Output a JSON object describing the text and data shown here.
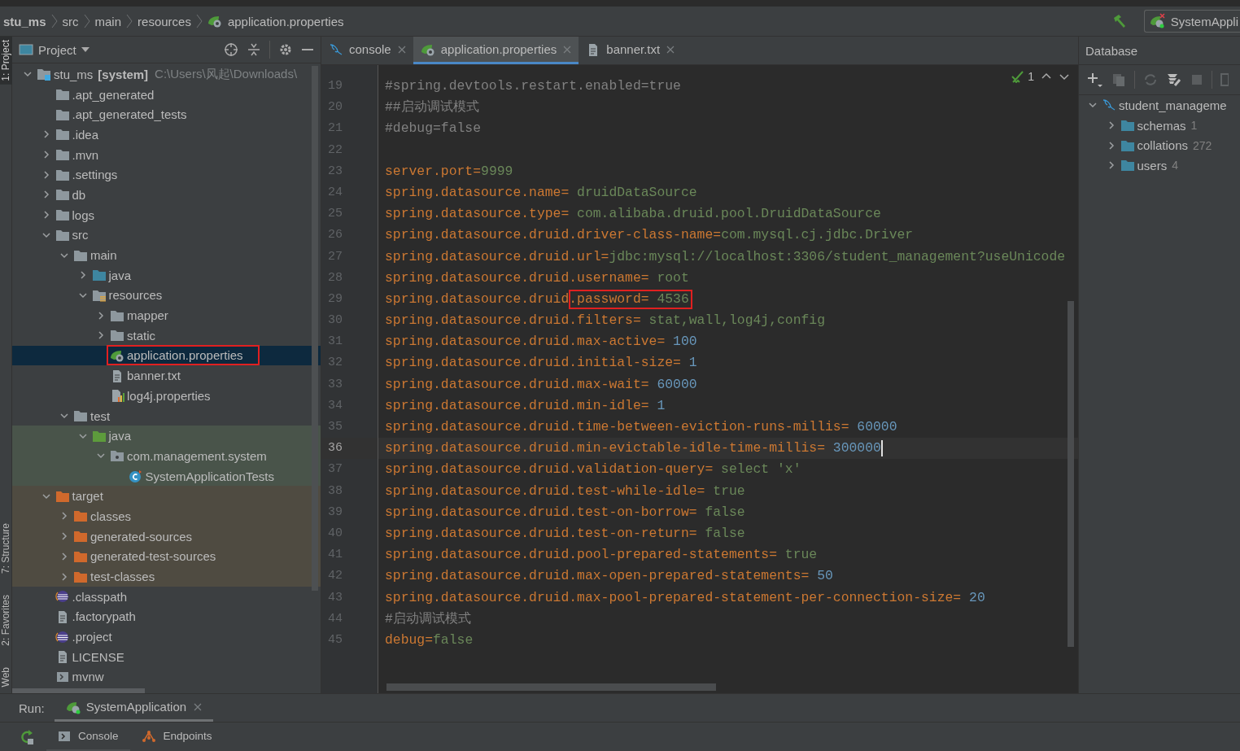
{
  "breadcrumbs": [
    {
      "label": "stu_ms",
      "bold": true
    },
    {
      "label": "src",
      "bold": false
    },
    {
      "label": "main",
      "bold": false
    },
    {
      "label": "resources",
      "bold": false
    },
    {
      "label": "application.properties",
      "bold": false,
      "kind": "spring"
    }
  ],
  "run_config": {
    "label": "SystemAppli"
  },
  "tool_strip": [
    {
      "label": "1: Project",
      "selected": true
    },
    {
      "label": "7: Structure",
      "selected": false
    },
    {
      "label": "2: Favorites",
      "selected": false
    },
    {
      "label": "Web",
      "selected": false
    }
  ],
  "project": {
    "title": "Project",
    "tree": [
      {
        "label": "stu_ms",
        "module": "[system]",
        "path": "C:\\Users\\风起\\Downloads\\",
        "kind": "module",
        "expanded": true,
        "selected": false,
        "children": [
          {
            "label": ".apt_generated",
            "kind": "folder",
            "selected": false
          },
          {
            "label": ".apt_generated_tests",
            "kind": "folder",
            "selected": false
          },
          {
            "label": ".idea",
            "kind": "folder",
            "expanded": false,
            "selected": false
          },
          {
            "label": ".mvn",
            "kind": "folder",
            "expanded": false,
            "selected": false
          },
          {
            "label": ".settings",
            "kind": "folder",
            "expanded": false,
            "selected": false
          },
          {
            "label": "db",
            "kind": "folder",
            "expanded": false,
            "selected": false
          },
          {
            "label": "logs",
            "kind": "folder",
            "expanded": false,
            "selected": false
          },
          {
            "label": "src",
            "kind": "folder",
            "expanded": true,
            "selected": false,
            "children": [
              {
                "label": "main",
                "kind": "folder",
                "expanded": true,
                "selected": false,
                "children": [
                  {
                    "label": "java",
                    "kind": "source",
                    "expanded": false,
                    "selected": false
                  },
                  {
                    "label": "resources",
                    "kind": "resources",
                    "expanded": true,
                    "selected": false,
                    "children": [
                      {
                        "label": "mapper",
                        "kind": "folder",
                        "expanded": false,
                        "selected": false
                      },
                      {
                        "label": "static",
                        "kind": "folder",
                        "expanded": false,
                        "selected": false
                      },
                      {
                        "label": "application.properties",
                        "kind": "spring",
                        "selected": true,
                        "boxed": true
                      },
                      {
                        "label": "banner.txt",
                        "kind": "text",
                        "selected": false
                      },
                      {
                        "label": "log4j.properties",
                        "kind": "log4j",
                        "selected": false
                      }
                    ]
                  }
                ]
              },
              {
                "label": "test",
                "kind": "folder",
                "expanded": true,
                "selected": false,
                "children": [
                  {
                    "label": "java",
                    "kind": "test",
                    "expanded": true,
                    "selected": false,
                    "children": [
                      {
                        "label": "com.management.system",
                        "kind": "package",
                        "expanded": true,
                        "selected": false,
                        "children": [
                          {
                            "label": "SystemApplicationTests",
                            "kind": "class",
                            "selected": false
                          }
                        ]
                      }
                    ]
                  }
                ]
              }
            ]
          },
          {
            "label": "target",
            "kind": "excluded",
            "expanded": true,
            "selected": false,
            "children": [
              {
                "label": "classes",
                "kind": "excluded",
                "expanded": false,
                "selected": false
              },
              {
                "label": "generated-sources",
                "kind": "excluded",
                "expanded": false,
                "selected": false
              },
              {
                "label": "generated-test-sources",
                "kind": "excluded",
                "expanded": false,
                "selected": false
              },
              {
                "label": "test-classes",
                "kind": "excluded",
                "expanded": false,
                "selected": false
              }
            ]
          },
          {
            "label": ".classpath",
            "kind": "eclipse",
            "selected": false
          },
          {
            "label": ".factorypath",
            "kind": "file",
            "selected": false
          },
          {
            "label": ".project",
            "kind": "eclipse",
            "selected": false
          },
          {
            "label": "LICENSE",
            "kind": "file",
            "selected": false
          },
          {
            "label": "mvnw",
            "kind": "script",
            "selected": false
          }
        ]
      }
    ]
  },
  "editor": {
    "tabs": [
      {
        "label": "console",
        "kind": "mysql",
        "selected": false
      },
      {
        "label": "application.properties",
        "kind": "spring",
        "selected": true
      },
      {
        "label": "banner.txt",
        "kind": "text",
        "selected": false
      }
    ],
    "inspection_count": "1",
    "lines": [
      {
        "number": "19",
        "current": false,
        "segments": [
          {
            "kind": "comment",
            "text": "#spring.devtools.restart.enabled=true"
          }
        ]
      },
      {
        "number": "20",
        "current": false,
        "segments": [
          {
            "kind": "comment",
            "text": "##启动调试模式"
          }
        ]
      },
      {
        "number": "21",
        "current": false,
        "segments": [
          {
            "kind": "comment",
            "text": "#debug=false"
          }
        ]
      },
      {
        "number": "22",
        "current": false
      },
      {
        "number": "23",
        "current": false,
        "segments": [
          {
            "kind": "key",
            "text": "server.port="
          },
          {
            "kind": "value",
            "text": "9999"
          }
        ]
      },
      {
        "number": "24",
        "current": false,
        "segments": [
          {
            "kind": "key",
            "text": "spring.datasource.name="
          },
          {
            "kind": "value",
            "text": " druidDataSource"
          }
        ]
      },
      {
        "number": "25",
        "current": false,
        "segments": [
          {
            "kind": "key",
            "text": "spring.datasource.type="
          },
          {
            "kind": "value",
            "text": " com.alibaba.druid.pool.DruidDataSource"
          }
        ]
      },
      {
        "number": "26",
        "current": false,
        "segments": [
          {
            "kind": "key",
            "text": "spring.datasource.druid.driver-class-name="
          },
          {
            "kind": "value",
            "text": "com.mysql.cj.jdbc.Driver"
          }
        ]
      },
      {
        "number": "27",
        "current": false,
        "segments": [
          {
            "kind": "key",
            "text": "spring.datasource.druid.url="
          },
          {
            "kind": "value",
            "text": "jdbc:mysql://localhost:3306/student_management?useUnicode"
          }
        ]
      },
      {
        "number": "28",
        "current": false,
        "segments": [
          {
            "kind": "key",
            "text": "spring.datasource.druid.username="
          },
          {
            "kind": "value",
            "text": " root"
          }
        ]
      },
      {
        "number": "29",
        "current": false,
        "segments": [
          {
            "kind": "key",
            "text": "spring.datasource.druid"
          },
          {
            "kind": "key",
            "text": ".password=",
            "boxed": true
          },
          {
            "kind": "value",
            "text": " 4536",
            "boxed": true
          }
        ]
      },
      {
        "number": "30",
        "current": false,
        "segments": [
          {
            "kind": "key",
            "text": "spring.datasource.druid.filters="
          },
          {
            "kind": "value",
            "text": " stat,wall,log4j,config"
          }
        ]
      },
      {
        "number": "31",
        "current": false,
        "segments": [
          {
            "kind": "key",
            "text": "spring.datasource.druid.max-active="
          },
          {
            "kind": "number",
            "text": " 100"
          }
        ]
      },
      {
        "number": "32",
        "current": false,
        "segments": [
          {
            "kind": "key",
            "text": "spring.datasource.druid.initial-size="
          },
          {
            "kind": "number",
            "text": " 1"
          }
        ]
      },
      {
        "number": "33",
        "current": false,
        "segments": [
          {
            "kind": "key",
            "text": "spring.datasource.druid.max-wait="
          },
          {
            "kind": "number",
            "text": " 60000"
          }
        ]
      },
      {
        "number": "34",
        "current": false,
        "segments": [
          {
            "kind": "key",
            "text": "spring.datasource.druid.min-idle="
          },
          {
            "kind": "number",
            "text": " 1"
          }
        ]
      },
      {
        "number": "35",
        "current": false,
        "segments": [
          {
            "kind": "key",
            "text": "spring.datasource.druid.time-between-eviction-runs-millis="
          },
          {
            "kind": "number",
            "text": " 60000"
          }
        ]
      },
      {
        "number": "36",
        "current": true,
        "segments": [
          {
            "kind": "key",
            "text": "spring.datasource.druid.min-evictable-idle-time-millis="
          },
          {
            "kind": "number",
            "text": " 300000"
          }
        ]
      },
      {
        "number": "37",
        "current": false,
        "segments": [
          {
            "kind": "key",
            "text": "spring.datasource.druid.validation-query="
          },
          {
            "kind": "value",
            "text": " select 'x'"
          }
        ]
      },
      {
        "number": "38",
        "current": false,
        "segments": [
          {
            "kind": "key",
            "text": "spring.datasource.druid.test-while-idle="
          },
          {
            "kind": "value",
            "text": " true"
          }
        ]
      },
      {
        "number": "39",
        "current": false,
        "segments": [
          {
            "kind": "key",
            "text": "spring.datasource.druid.test-on-borrow="
          },
          {
            "kind": "value",
            "text": " false"
          }
        ]
      },
      {
        "number": "40",
        "current": false,
        "segments": [
          {
            "kind": "key",
            "text": "spring.datasource.druid.test-on-return="
          },
          {
            "kind": "value",
            "text": " false"
          }
        ]
      },
      {
        "number": "41",
        "current": false,
        "segments": [
          {
            "kind": "key",
            "text": "spring.datasource.druid.pool-prepared-statements="
          },
          {
            "kind": "value",
            "text": " true"
          }
        ]
      },
      {
        "number": "42",
        "current": false,
        "segments": [
          {
            "kind": "key",
            "text": "spring.datasource.druid.max-open-prepared-statements="
          },
          {
            "kind": "number",
            "text": " 50"
          }
        ]
      },
      {
        "number": "43",
        "current": false,
        "segments": [
          {
            "kind": "key",
            "text": "spring.datasource.druid.max-pool-prepared-statement-per-connection-size="
          },
          {
            "kind": "number",
            "text": " 20"
          }
        ]
      },
      {
        "number": "44",
        "current": false,
        "segments": [
          {
            "kind": "comment",
            "text": "#启动调试模式"
          }
        ]
      },
      {
        "number": "45",
        "current": false,
        "segments": [
          {
            "kind": "key",
            "text": "debug="
          },
          {
            "kind": "value",
            "text": "false"
          }
        ]
      }
    ]
  },
  "database": {
    "title": "Database",
    "tree": [
      {
        "label": "student_manageme",
        "kind": "mysql",
        "expanded": true,
        "selected": false,
        "children": [
          {
            "label": "schemas",
            "count": "1",
            "kind": "folder",
            "expanded": false,
            "selected": false
          },
          {
            "label": "collations",
            "count": "272",
            "kind": "folder",
            "expanded": false,
            "selected": false
          },
          {
            "label": "users",
            "count": "4",
            "kind": "folder",
            "expanded": false,
            "selected": false
          }
        ]
      }
    ]
  },
  "run": {
    "label": "Run:",
    "tabs": [
      {
        "label": "SystemApplication",
        "selected": true
      }
    ],
    "bottom_tabs": [
      {
        "label": "Console",
        "kind": "console",
        "selected": true
      },
      {
        "label": "Endpoints",
        "kind": "endpoints",
        "selected": false
      }
    ]
  }
}
